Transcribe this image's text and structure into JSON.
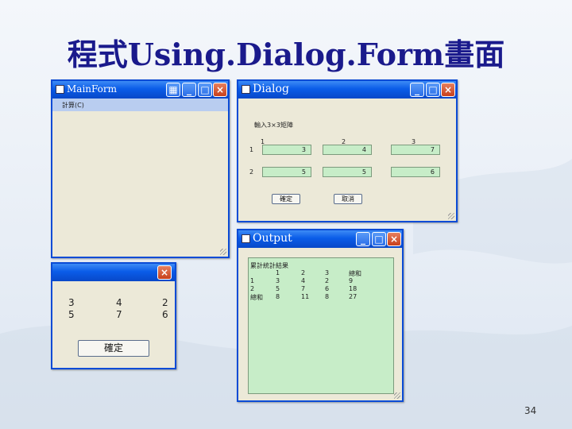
{
  "slide": {
    "title": "程式Using.Dialog.Form畫面",
    "page_number": "34"
  },
  "main_form": {
    "title": "MainForm",
    "menu_item": "計算(C)",
    "icons": [
      "table-icon",
      "minimize-icon",
      "maximize-icon",
      "close-icon"
    ]
  },
  "dialog": {
    "title": "Dialog",
    "prompt": "輸入3×3矩陣",
    "col_headers": [
      "1",
      "2",
      "3"
    ],
    "row_labels": [
      "1",
      "2"
    ],
    "rows": [
      [
        "3",
        "4",
        "7"
      ],
      [
        "5",
        "5",
        "6"
      ]
    ],
    "ok_label": "確定",
    "cancel_label": "取消"
  },
  "msgbox": {
    "lines": [
      [
        "3",
        "4",
        "2"
      ],
      [
        "5",
        "7",
        "6"
      ]
    ],
    "ok_label": "確定"
  },
  "output": {
    "title": "Output",
    "heading": "累計統計結果",
    "header": [
      "",
      "1",
      "2",
      "3",
      "總和"
    ],
    "rows": [
      [
        "1",
        "3",
        "4",
        "2",
        "9"
      ],
      [
        "2",
        "5",
        "7",
        "6",
        "18"
      ],
      [
        "總和",
        "8",
        "11",
        "8",
        "27"
      ]
    ]
  },
  "colors": {
    "title_blue": "#1a1a8c",
    "xp_titlebar": "#0a5ce8",
    "field_green": "#c7edc8"
  }
}
